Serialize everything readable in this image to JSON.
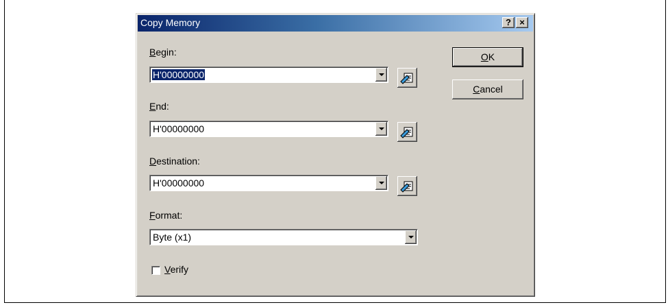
{
  "window": {
    "title": "Copy Memory"
  },
  "titlebar": {
    "help_label": "?",
    "close_label": "×"
  },
  "fields": {
    "begin": {
      "label_key": "B",
      "label_rest": "egin:",
      "value": "H'00000000",
      "picker_icon": "address-picker-icon"
    },
    "end": {
      "label_key": "E",
      "label_rest": "nd:",
      "value": "H'00000000",
      "picker_icon": "address-picker-icon"
    },
    "destination": {
      "label_key": "D",
      "label_rest": "estination:",
      "value": "H'00000000",
      "picker_icon": "address-picker-icon"
    },
    "format": {
      "label_key": "F",
      "label_rest": "ormat:",
      "value": "Byte (x1)"
    }
  },
  "verify": {
    "label_key": "V",
    "label_rest": "erify",
    "checked": false
  },
  "buttons": {
    "ok": {
      "key": "O",
      "rest": "K"
    },
    "cancel": {
      "key": "C",
      "rest": "ancel"
    }
  },
  "colors": {
    "titlebar_start": "#0a246a",
    "titlebar_end": "#a6caf0",
    "dialog_bg": "#d4d0c8",
    "selection": "#0a246a"
  }
}
